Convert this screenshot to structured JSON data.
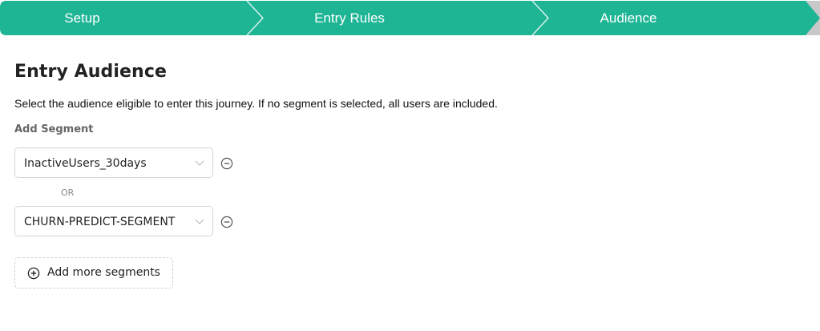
{
  "stepper": {
    "steps": [
      {
        "label": "Setup"
      },
      {
        "label": "Entry Rules"
      },
      {
        "label": "Audience"
      }
    ],
    "color": "#1eb595",
    "divider_color": "#e8f7f3",
    "track_end_color": "#c8c8c8"
  },
  "main": {
    "title": "Entry Audience",
    "description": "Select the audience eligible to enter this journey. If no segment is selected, all users are included.",
    "add_segment_label": "Add Segment",
    "segments": [
      {
        "value": "InactiveUsers_30days",
        "dropdown_icon": "chevron-down-icon",
        "remove_icon": "minus-circle-icon"
      },
      {
        "value": "CHURN-PREDICT-SEGMENT",
        "dropdown_icon": "chevron-down-icon",
        "remove_icon": "minus-circle-icon"
      }
    ],
    "or_separator": "OR",
    "add_more": {
      "label": "Add more segments",
      "icon": "plus-circle-icon"
    }
  }
}
